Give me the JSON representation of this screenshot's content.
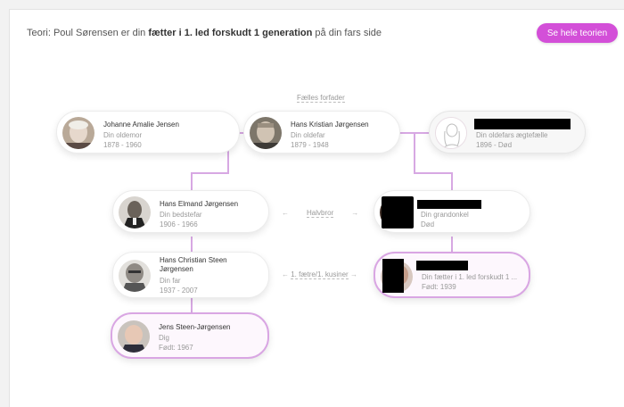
{
  "header": {
    "theory_prefix": "Teori: Poul Sørensen er din",
    "theory_relation": "fætter i 1. led forskudt 1 generation",
    "theory_suffix": "på din fars side",
    "button_label": "Se hele teorien"
  },
  "common_ancestors_label": "Fælles forfader",
  "cards": {
    "johanne": {
      "name": "Johanne Amalie Jensen",
      "relation": "Din oldemor",
      "years": "1878 - 1960"
    },
    "hans_kristian": {
      "name": "Hans Kristian Jørgensen",
      "relation": "Din oldefar",
      "years": "1879 - 1948"
    },
    "spouse": {
      "name": "",
      "relation": "Din oldefars ægtefælle",
      "years": "1896 - Død"
    },
    "hans_elmand": {
      "name": "Hans Elmand Jørgensen",
      "relation": "Din bedstefar",
      "years": "1906 - 1966"
    },
    "granduncle": {
      "name": "",
      "relation": "Din grandonkel",
      "years": "Død"
    },
    "hans_christian": {
      "name": "Hans Christian Steen Jørgensen",
      "relation": "Din far",
      "years": "1937 - 2007"
    },
    "cousin": {
      "name": "",
      "relation": "Din fætter i 1. led forskudt 1 ...",
      "years": "Født: 1939"
    },
    "jens": {
      "name": "Jens Steen-Jørgensen",
      "relation": "Dig",
      "years": "Født: 1967"
    }
  },
  "relations": {
    "half_brother": "Halvbror",
    "cousin": "1. fætre/1. kusiner"
  },
  "icons": {
    "arrow_left": "←",
    "arrow_right": "→"
  },
  "colors": {
    "accent": "#d34fd8",
    "connector": "#d7a8e3"
  }
}
